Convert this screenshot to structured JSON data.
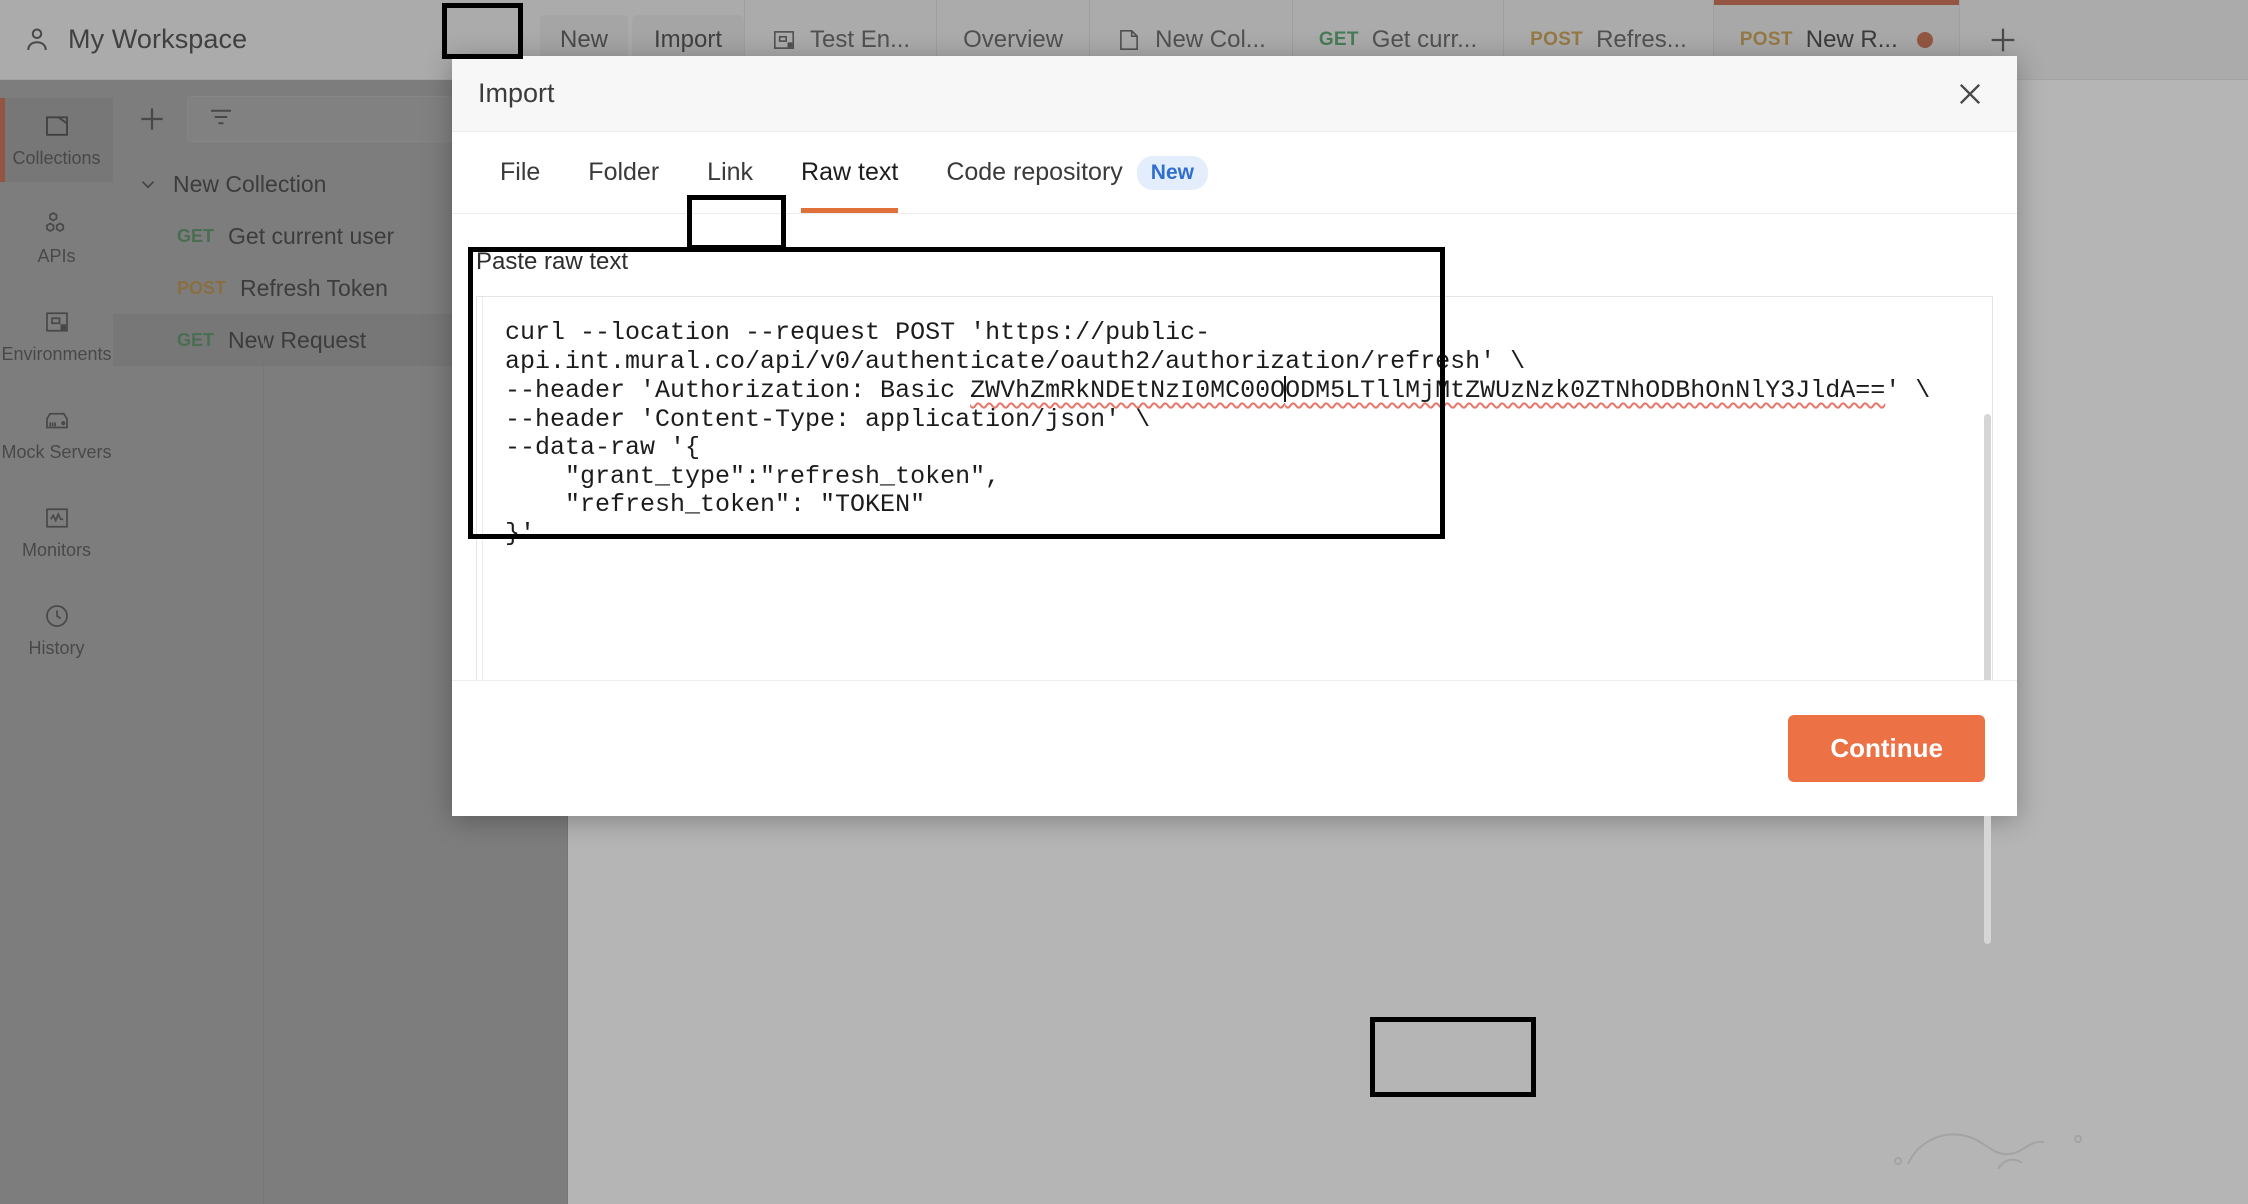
{
  "workspace": {
    "title": "My Workspace",
    "icon": "person-icon",
    "new_label": "New",
    "import_label": "Import"
  },
  "tabs": [
    {
      "icon": "environment-icon",
      "method": "",
      "label": "Test En...",
      "active": false,
      "unsaved": false
    },
    {
      "icon": "",
      "method": "",
      "label": "Overview",
      "active": false,
      "unsaved": false
    },
    {
      "icon": "collection-icon",
      "method": "",
      "label": "New Col...",
      "active": false,
      "unsaved": false
    },
    {
      "icon": "",
      "method": "GET",
      "label": "Get curr...",
      "active": false,
      "unsaved": false
    },
    {
      "icon": "",
      "method": "POST",
      "label": "Refres...",
      "active": false,
      "unsaved": false
    },
    {
      "icon": "",
      "method": "POST",
      "label": "New R...",
      "active": true,
      "unsaved": true
    }
  ],
  "tab_add_label": "+",
  "rail": [
    {
      "icon": "collections-icon",
      "label": "Collections",
      "active": true
    },
    {
      "icon": "apis-icon",
      "label": "APIs",
      "active": false
    },
    {
      "icon": "environments-icon",
      "label": "Environments",
      "active": false
    },
    {
      "icon": "mock-servers-icon",
      "label": "Mock Servers",
      "active": false
    },
    {
      "icon": "monitors-icon",
      "label": "Monitors",
      "active": false
    },
    {
      "icon": "history-icon",
      "label": "History",
      "active": false
    }
  ],
  "sidebar": {
    "add_icon": "plus-icon",
    "filter_icon": "filter-icon",
    "tree": [
      {
        "type": "collection",
        "chevron": "chevron-down-icon",
        "label": "New Collection",
        "method": "",
        "selected": false
      },
      {
        "type": "request",
        "label": "Get current user",
        "method": "GET",
        "selected": false
      },
      {
        "type": "request",
        "label": "Refresh Token",
        "method": "POST",
        "selected": false
      },
      {
        "type": "request",
        "label": "New Request",
        "method": "GET",
        "selected": true
      }
    ]
  },
  "modal": {
    "title": "Import",
    "close_icon": "close-icon",
    "tabs": [
      {
        "label": "File",
        "active": false,
        "badge": ""
      },
      {
        "label": "Folder",
        "active": false,
        "badge": ""
      },
      {
        "label": "Link",
        "active": false,
        "badge": ""
      },
      {
        "label": "Raw text",
        "active": true,
        "badge": ""
      },
      {
        "label": "Code repository",
        "active": false,
        "badge": "New"
      }
    ],
    "paste_label": "Paste raw text",
    "raw_text": {
      "line1": "curl --location --request POST 'https://public-",
      "line2": "api.int.mural.co/api/v0/authenticate/oauth2/authorization/refresh' \\",
      "line3_prefix": "--header 'Authorization: Basic ",
      "line3_token_a": "ZWVhZmRkNDEtNzI0MC00O",
      "line3_token_b": "ODM5LTllMjMtZWUzNzk0ZTNhODBhOnNlY3JldA==",
      "line3_suffix": "' \\",
      "line4": "--header 'Content-Type: application/json' \\",
      "line5": "--data-raw '{",
      "line6": "    \"grant_type\":\"refresh_token\",",
      "line7": "    \"refresh_token\": \"TOKEN\"",
      "line8": "}'"
    },
    "continue_label": "Continue"
  },
  "colors": {
    "accent_orange": "#ec7145",
    "tab_active_bar": "#c1502e",
    "method_get": "#3a9655",
    "method_post": "#c59336",
    "badge_blue": "#2f6fd0",
    "spellcheck_red": "#e8756a"
  }
}
